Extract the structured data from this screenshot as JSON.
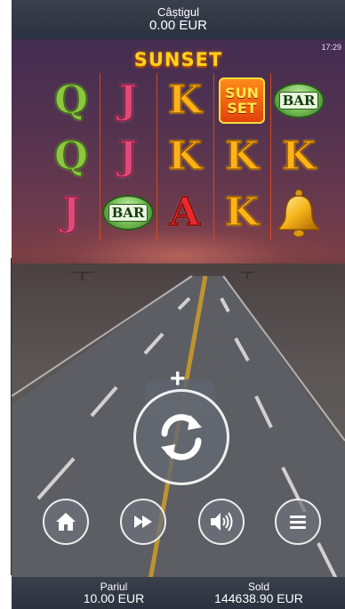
{
  "header": {
    "win_label": "Câștigul",
    "win_value": "0.00 EUR",
    "clock": "17:29"
  },
  "game": {
    "logo_text": "SUNSET"
  },
  "reels": [
    [
      "Q",
      "J",
      "K",
      "SUNSET",
      "BAR"
    ],
    [
      "Q",
      "J",
      "K",
      "K",
      "K"
    ],
    [
      "J",
      "BAR",
      "A",
      "K",
      "BELL"
    ]
  ],
  "sunset_tile": {
    "line1": "SUN",
    "line2": "SET"
  },
  "controls": {
    "increase_bet_icon": "plus-icon",
    "spin_icon": "refresh-arrows-icon",
    "home_icon": "home-icon",
    "autoplay_icon": "fast-forward-icon",
    "sound_icon": "speaker-icon",
    "menu_icon": "hamburger-menu-icon"
  },
  "footer": {
    "bet_label": "Pariul",
    "bet_value": "10.00 EUR",
    "balance_label": "Sold",
    "balance_value": "144638.90 EUR"
  },
  "colors": {
    "bar_bg": "#2d3240",
    "reel_divider": "#e24a16",
    "logo": "#ffd21a"
  }
}
